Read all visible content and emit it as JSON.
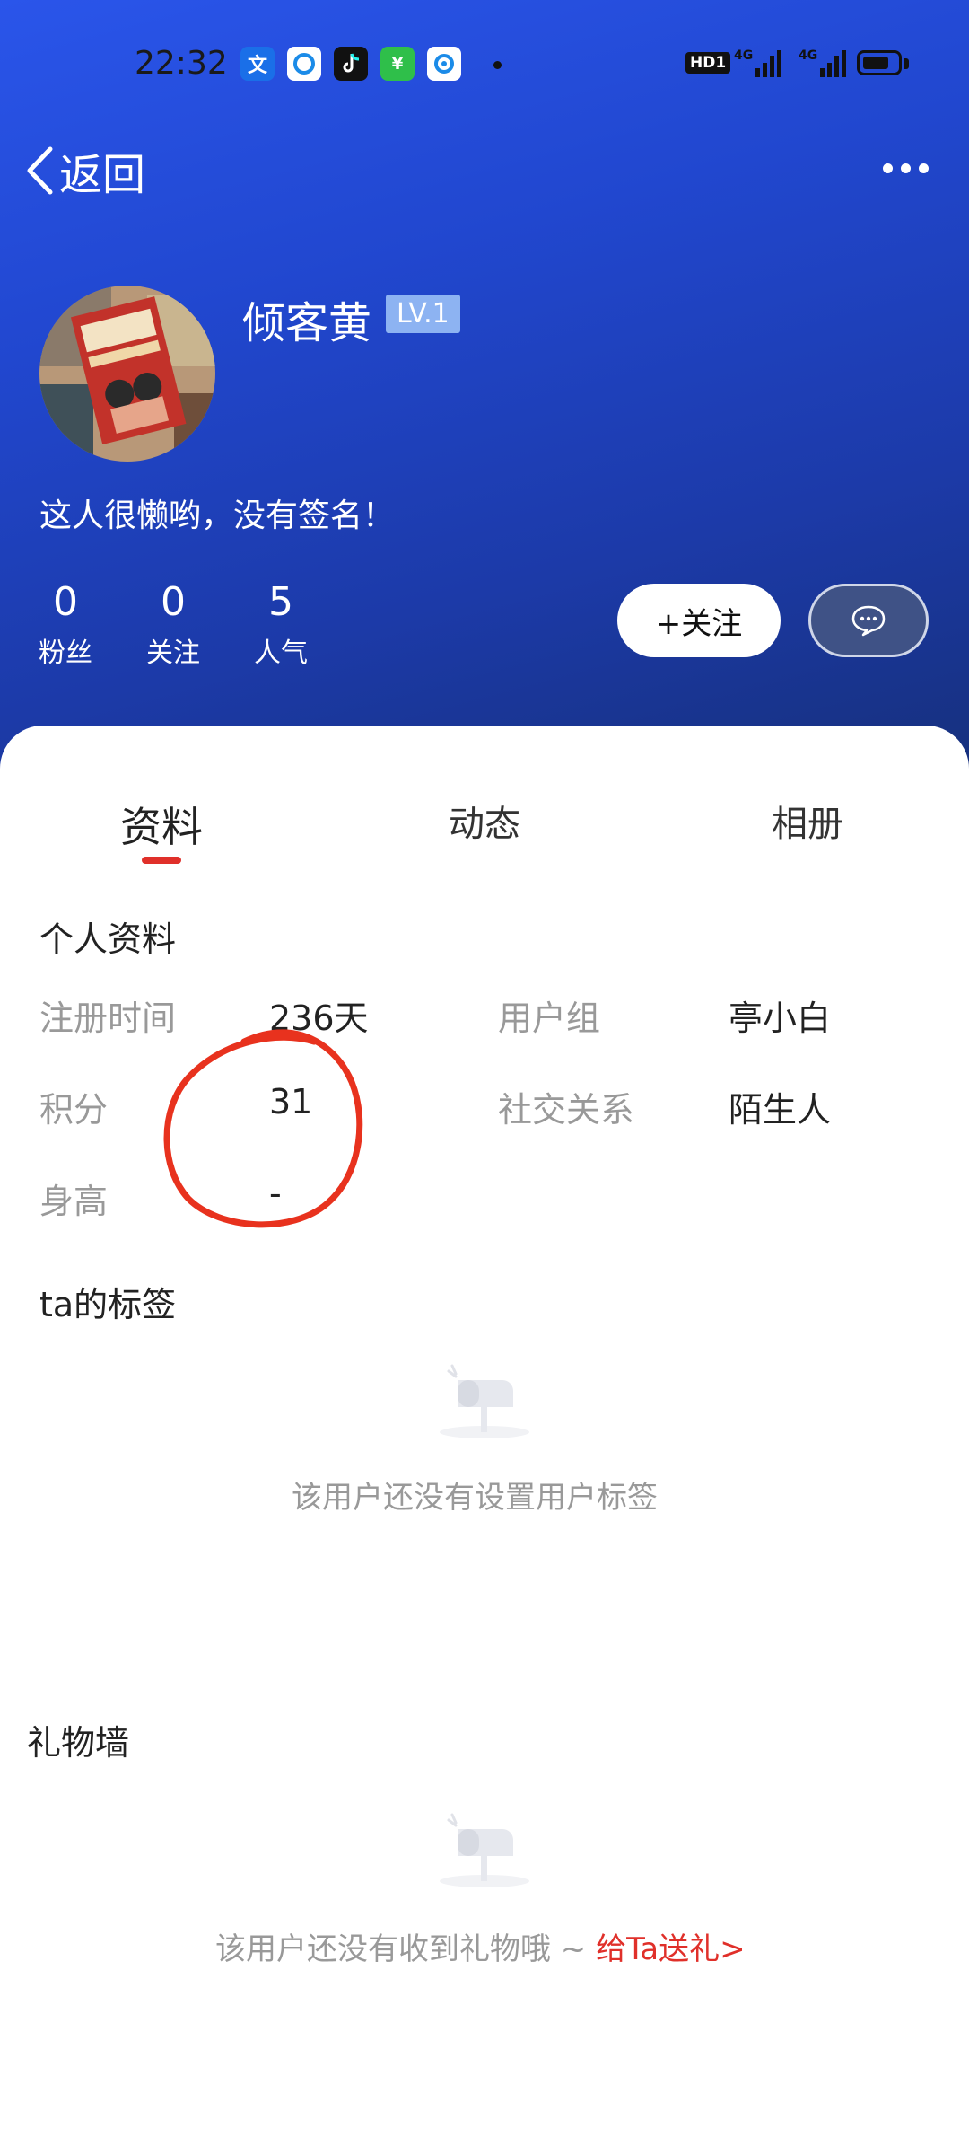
{
  "status_bar": {
    "time": "22:32",
    "hd": "HD1",
    "sig1": "4G",
    "sig2": "4G",
    "app_icons": [
      "translate-app-icon",
      "browser-app-icon",
      "tiktok-app-icon",
      "wechat-mini-app-icon",
      "qq-browser-app-icon"
    ]
  },
  "nav": {
    "back_label": "返回"
  },
  "profile": {
    "name": "倾客黄",
    "level": "LV.1",
    "signature": "这人很懒哟，没有签名！",
    "stats": [
      {
        "value": "0",
        "label": "粉丝"
      },
      {
        "value": "0",
        "label": "关注"
      },
      {
        "value": "5",
        "label": "人气"
      }
    ],
    "follow_label": "+关注"
  },
  "tabs": [
    {
      "label": "资料",
      "active": true
    },
    {
      "label": "动态",
      "active": false
    },
    {
      "label": "相册",
      "active": false
    }
  ],
  "info": {
    "title": "个人资料",
    "rows": [
      {
        "label": "注册时间",
        "value": "236天",
        "label2": "用户组",
        "value2": "亭小白"
      },
      {
        "label": "积分",
        "value": "31",
        "label2": "社交关系",
        "value2": "陌生人"
      },
      {
        "label": "身高",
        "value": "-"
      }
    ]
  },
  "tags": {
    "title": "ta的标签",
    "empty_text": "该用户还没有设置用户标签"
  },
  "gifts": {
    "title": "礼物墙",
    "empty_text": "该用户还没有收到礼物哦 ~ ",
    "gift_link": "给Ta送礼>"
  },
  "colors": {
    "header_gradient_start": "#2a55ea",
    "header_gradient_end": "#16307d",
    "accent_red": "#e0302a",
    "annotation_circle": "#e8321e",
    "level_badge": "#8db3f2"
  }
}
